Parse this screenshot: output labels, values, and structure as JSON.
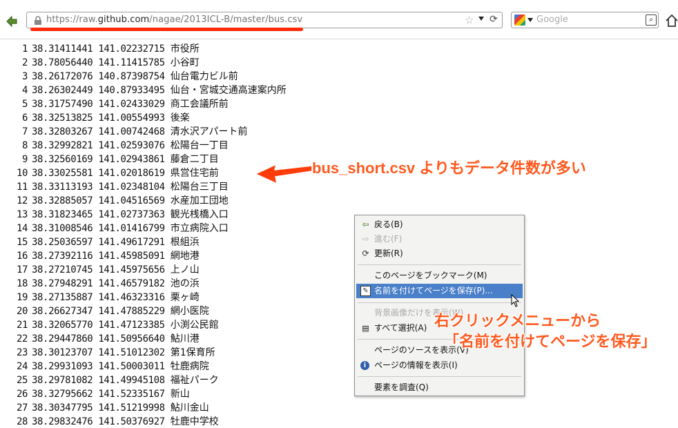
{
  "browser": {
    "url_prefix": "https://raw.",
    "url_host": "github.com",
    "url_path": "/nagae/2013ICL-B/master/bus.csv",
    "search_placeholder": "Google"
  },
  "rows": [
    {
      "n": "1",
      "lat": "38.31411441",
      "lon": "141.02232715",
      "name": "市役所"
    },
    {
      "n": "2",
      "lat": "38.78056440",
      "lon": "141.11415785",
      "name": "小谷町"
    },
    {
      "n": "3",
      "lat": "38.26172076",
      "lon": "140.87398754",
      "name": "仙台電力ビル前"
    },
    {
      "n": "4",
      "lat": "38.26302449",
      "lon": "140.87933495",
      "name": "仙台・宮城交通高速案内所"
    },
    {
      "n": "5",
      "lat": "38.31757490",
      "lon": "141.02433029",
      "name": "商工会議所前"
    },
    {
      "n": "6",
      "lat": "38.32513825",
      "lon": "141.00554993",
      "name": "後楽"
    },
    {
      "n": "7",
      "lat": "38.32803267",
      "lon": "141.00742468",
      "name": "清水沢アパート前"
    },
    {
      "n": "8",
      "lat": "38.32992821",
      "lon": "141.02593076",
      "name": "松陽台一丁目"
    },
    {
      "n": "9",
      "lat": "38.32560169",
      "lon": "141.02943861",
      "name": "藤倉二丁目"
    },
    {
      "n": "10",
      "lat": "38.33025581",
      "lon": "141.02018619",
      "name": "県営住宅前"
    },
    {
      "n": "11",
      "lat": "38.33113193",
      "lon": "141.02348104",
      "name": "松陽台三丁目"
    },
    {
      "n": "12",
      "lat": "38.32885057",
      "lon": "141.04516569",
      "name": "水産加工団地"
    },
    {
      "n": "13",
      "lat": "38.31823465",
      "lon": "141.02737363",
      "name": "観光桟橋入口"
    },
    {
      "n": "14",
      "lat": "38.31008546",
      "lon": "141.01416799",
      "name": "市立病院入口"
    },
    {
      "n": "15",
      "lat": "38.25036597",
      "lon": "141.49617291",
      "name": "根組浜"
    },
    {
      "n": "16",
      "lat": "38.27392116",
      "lon": "141.45985091",
      "name": "網地港"
    },
    {
      "n": "17",
      "lat": "38.27210745",
      "lon": "141.45975656",
      "name": "上ノ山"
    },
    {
      "n": "18",
      "lat": "38.27948291",
      "lon": "141.46579182",
      "name": "池の浜"
    },
    {
      "n": "19",
      "lat": "38.27135887",
      "lon": "141.46323316",
      "name": "栗ヶ崎"
    },
    {
      "n": "20",
      "lat": "38.26627347",
      "lon": "141.47885229",
      "name": "網小医院"
    },
    {
      "n": "21",
      "lat": "38.32065770",
      "lon": "141.47123385",
      "name": "小渕公民館"
    },
    {
      "n": "22",
      "lat": "38.29447860",
      "lon": "141.50956640",
      "name": "鮎川港"
    },
    {
      "n": "23",
      "lat": "38.30123707",
      "lon": "141.51012302",
      "name": "第1保育所"
    },
    {
      "n": "24",
      "lat": "38.29931093",
      "lon": "141.50003011",
      "name": "牡鹿病院"
    },
    {
      "n": "25",
      "lat": "38.29781082",
      "lon": "141.49945108",
      "name": "福祉パーク"
    },
    {
      "n": "26",
      "lat": "38.32795662",
      "lon": "141.52335167",
      "name": "新山"
    },
    {
      "n": "27",
      "lat": "38.30347795",
      "lon": "141.51219998",
      "name": "鮎川金山"
    },
    {
      "n": "28",
      "lat": "38.29832476",
      "lon": "141.50376927",
      "name": "牡鹿中学校"
    }
  ],
  "context_menu": {
    "back": "戻る(B)",
    "forward": "進む(F)",
    "reload": "更新(R)",
    "bookmark": "このページをブックマーク(M)",
    "save_as": "名前を付けてページを保存(P)...",
    "view_bg": "背景画像だけを表示(W)",
    "select_all": "すべて選択(A)",
    "view_source": "ページのソースを表示(V)",
    "page_info": "ページの情報を表示(I)",
    "inspect": "要素を調査(Q)"
  },
  "annotations": {
    "note1": "bus_short.csv よりもデータ件数が多い",
    "note2_line1": "右クリックメニューから",
    "note2_line2": "「名前を付けてページを保存」"
  },
  "colors": {
    "accent": "#ff5a1f",
    "highlight": "#4a7fc9",
    "underline": "#ff2a0a"
  }
}
